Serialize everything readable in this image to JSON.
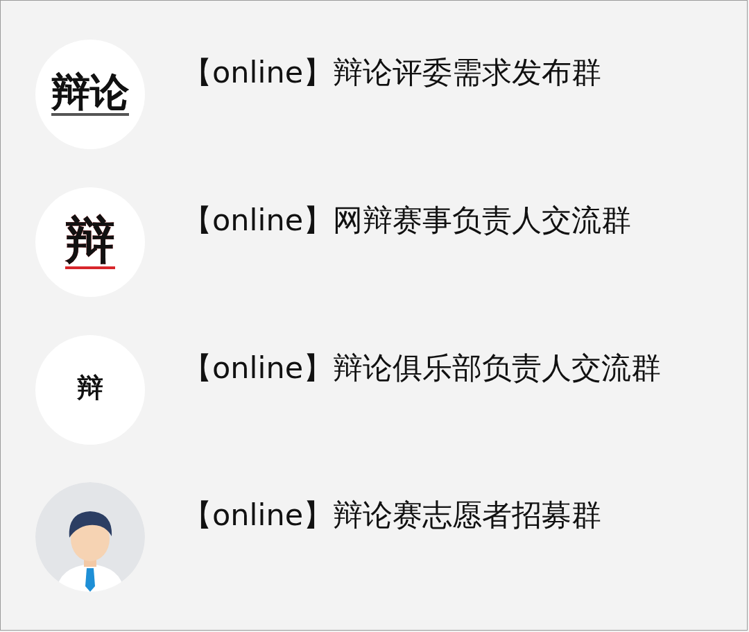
{
  "groups": [
    {
      "name": "【online】辩论评委需求发布群",
      "avatar": {
        "kind": "logo",
        "text": "辩论",
        "color": "#555555"
      }
    },
    {
      "name": "【online】网辩赛事负责人交流群",
      "avatar": {
        "kind": "logo",
        "text": "辩",
        "color": "#d8262b"
      }
    },
    {
      "name": "【online】辩论俱乐部负责人交流群",
      "avatar": {
        "kind": "small-logo",
        "text": "辩"
      }
    },
    {
      "name": "【online】辩论赛志愿者招募群",
      "avatar": {
        "kind": "person"
      }
    }
  ]
}
